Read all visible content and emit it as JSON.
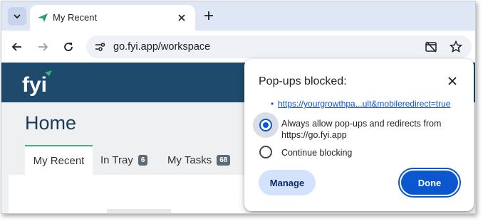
{
  "browser": {
    "tab": {
      "title": "My Recent"
    },
    "omnibox": {
      "url": "go.fyi.app/workspace"
    }
  },
  "page": {
    "logo_text": "fyi",
    "title": "Home",
    "tabs": [
      {
        "label": "My Recent"
      },
      {
        "label": "In Tray",
        "badge": "6"
      },
      {
        "label": "My Tasks",
        "badge": "68"
      }
    ]
  },
  "popup": {
    "title": "Pop-ups blocked:",
    "link": "https://yourgrowthpa...ult&mobileredirect=true",
    "option_allow_line1": "Always allow pop-ups and redirects from",
    "option_allow_line2": "https://go.fyi.app",
    "option_block": "Continue blocking",
    "manage_label": "Manage",
    "done_label": "Done"
  },
  "colors": {
    "tabstrip": "#dfe7f7",
    "site_header": "#1e4a6e",
    "accent": "#0b57d0",
    "active_tab_border": "#36b37e"
  }
}
